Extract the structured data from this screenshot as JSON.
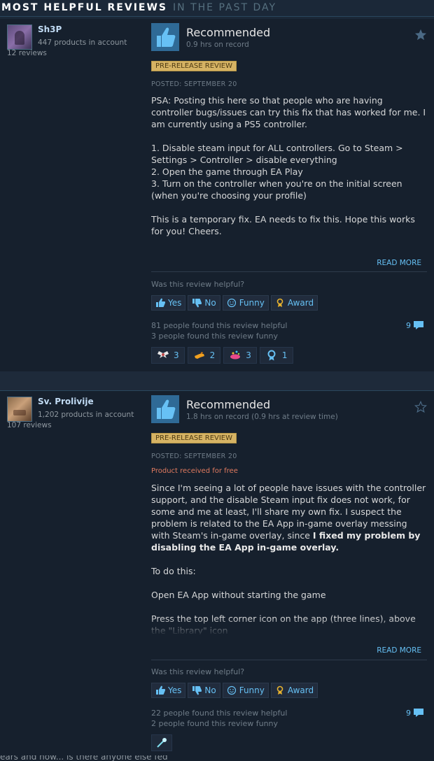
{
  "header": {
    "title": "MOST HELPFUL REVIEWS",
    "subtitle": "IN THE PAST DAY"
  },
  "reviews": [
    {
      "author": "Sh3P",
      "products": "447 products in account",
      "review_count": "12 reviews",
      "verdict": "Recommended",
      "hours": "0.9 hrs on record",
      "badge": "PRE-RELEASE REVIEW",
      "posted": "POSTED: SEPTEMBER 20",
      "body": "PSA: Posting this here so that people who are having controller bugs/issues can try this fix that has worked for me. I am currently using a PS5 controller.\n\n1. Disable steam input for ALL controllers. Go to Steam > Settings > Controller > disable everything\n2. Open the game through EA Play\n3. Turn on the controller when you're on the initial screen (when you're choosing your profile)\n\nThis is a temporary fix. EA needs to fix this. Hope this works for you! Cheers.",
      "read_more": "READ MORE",
      "helpful_question": "Was this review helpful?",
      "votes": {
        "yes": "Yes",
        "no": "No",
        "funny": "Funny",
        "award": "Award"
      },
      "helpful_count": "81 people found this review helpful",
      "funny_count": "3 people found this review funny",
      "comment_count": "9",
      "awards": [
        "3",
        "2",
        "3",
        "1"
      ]
    },
    {
      "author": "Sv. Prolivije",
      "products": "1,202 products in account",
      "review_count": "107 reviews",
      "verdict": "Recommended",
      "hours": "1.8 hrs on record (0.9 hrs at review time)",
      "badge": "PRE-RELEASE REVIEW",
      "posted": "POSTED: SEPTEMBER 20",
      "free_note": "Product received for free",
      "body_before": "Since I'm seeing a lot of people have issues with the controller support, and the disable Steam input fix does not work, for some and me at least, I'll share my own fix. I suspect the problem is related to the EA App in-game overlay messing with Steam's in-game overlay, since ",
      "body_bold": "I fixed my problem by disabling the EA App in-game overlay.",
      "body_after": "\n\nTo do this:\n\nOpen EA App without starting the game\n\nPress the top left corner icon on the app (three lines), above the \"Library\" icon",
      "read_more": "READ MORE",
      "helpful_question": "Was this review helpful?",
      "votes": {
        "yes": "Yes",
        "no": "No",
        "funny": "Funny",
        "award": "Award"
      },
      "helpful_count": "22 people found this review helpful",
      "funny_count": "2 people found this review funny",
      "comment_count": "9"
    }
  ],
  "cutoff_text": "ears and now... is there anyone else fed",
  "colors": {
    "background": "#1b2838",
    "link_blue": "#66c0f4",
    "badge_gold": "#d6b364",
    "free_note": "#e07a5f"
  }
}
